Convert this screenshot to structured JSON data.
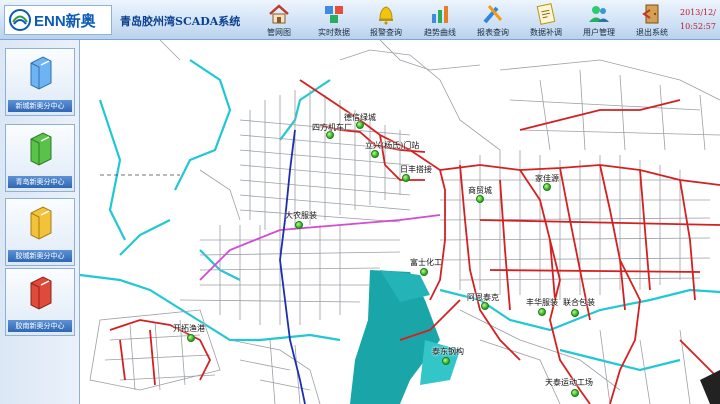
{
  "header": {
    "logo_text": "ENN新奥",
    "title": "青岛胶州湾SCADA系统",
    "date": "2013/12/",
    "time": "10:52:57"
  },
  "toolbar": [
    {
      "label": "管网图",
      "icon": "home-icon"
    },
    {
      "label": "实时数据",
      "icon": "data-cubes-icon"
    },
    {
      "label": "报警查询",
      "icon": "bell-icon"
    },
    {
      "label": "趋势曲线",
      "icon": "trend-chart-icon"
    },
    {
      "label": "报表查询",
      "icon": "report-tools-icon"
    },
    {
      "label": "数据补调",
      "icon": "edit-note-icon"
    },
    {
      "label": "用户管理",
      "icon": "users-icon"
    },
    {
      "label": "退出系统",
      "icon": "exit-door-icon"
    }
  ],
  "sidebar": [
    {
      "label": "新城新奥分中心",
      "color": "#6fb4f2"
    },
    {
      "label": "青岛新奥分中心",
      "color": "#58c24a"
    },
    {
      "label": "胶城新奥分中心",
      "color": "#f2c238"
    },
    {
      "label": "胶南新奥分中心",
      "color": "#e04a3a"
    }
  ],
  "stations": [
    {
      "name": "德信绿城"
    },
    {
      "name": "四方机车厂"
    },
    {
      "name": "立兴(杨氏)门站"
    },
    {
      "name": "日丰搭接"
    },
    {
      "name": "商贸城"
    },
    {
      "name": "家佳源"
    },
    {
      "name": "大农服装"
    },
    {
      "name": "富士化工"
    },
    {
      "name": "阿恩泰克"
    },
    {
      "name": "丰华服装"
    },
    {
      "name": "联合包装"
    },
    {
      "name": "开拓渔港"
    },
    {
      "name": "泰东钢构"
    },
    {
      "name": "天泰运动工场"
    }
  ]
}
